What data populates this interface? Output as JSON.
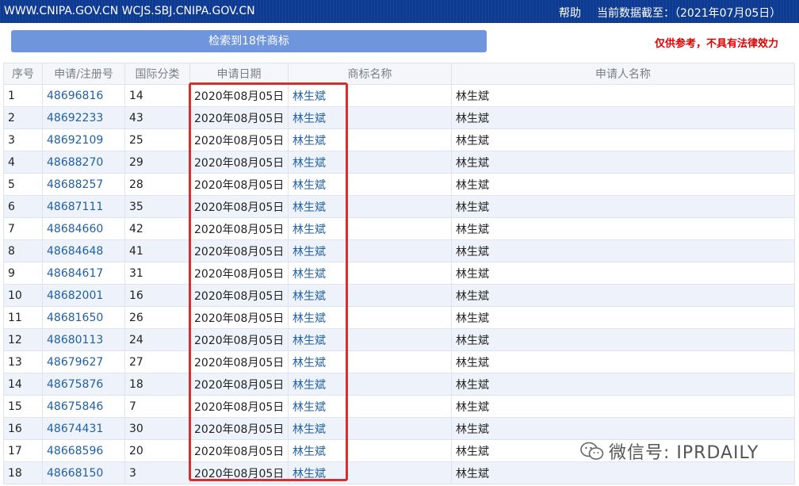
{
  "topbar": {
    "site": "WWW.CNIPA.GOV.CN WCJS.SBJ.CNIPA.GOV.CN",
    "help": "帮助",
    "as_of": "当前数据截至：（2021年07月05日）"
  },
  "result_summary": "检索到18件商标",
  "disclaimer": "仅供参考，不具有法律效力",
  "table": {
    "headers": [
      "序号",
      "申请/注册号",
      "国际分类",
      "申请日期",
      "商标名称",
      "申请人名称"
    ],
    "rows": [
      {
        "no": "1",
        "reg": "48696816",
        "cls": "14",
        "date": "2020年08月05日",
        "name": "林生斌",
        "applicant": "林生斌"
      },
      {
        "no": "2",
        "reg": "48692233",
        "cls": "43",
        "date": "2020年08月05日",
        "name": "林生斌",
        "applicant": "林生斌"
      },
      {
        "no": "3",
        "reg": "48692109",
        "cls": "25",
        "date": "2020年08月05日",
        "name": "林生斌",
        "applicant": "林生斌"
      },
      {
        "no": "4",
        "reg": "48688270",
        "cls": "29",
        "date": "2020年08月05日",
        "name": "林生斌",
        "applicant": "林生斌"
      },
      {
        "no": "5",
        "reg": "48688257",
        "cls": "28",
        "date": "2020年08月05日",
        "name": "林生斌",
        "applicant": "林生斌"
      },
      {
        "no": "6",
        "reg": "48687111",
        "cls": "35",
        "date": "2020年08月05日",
        "name": "林生斌",
        "applicant": "林生斌"
      },
      {
        "no": "7",
        "reg": "48684660",
        "cls": "42",
        "date": "2020年08月05日",
        "name": "林生斌",
        "applicant": "林生斌"
      },
      {
        "no": "8",
        "reg": "48684648",
        "cls": "41",
        "date": "2020年08月05日",
        "name": "林生斌",
        "applicant": "林生斌"
      },
      {
        "no": "9",
        "reg": "48684617",
        "cls": "31",
        "date": "2020年08月05日",
        "name": "林生斌",
        "applicant": "林生斌"
      },
      {
        "no": "10",
        "reg": "48682001",
        "cls": "16",
        "date": "2020年08月05日",
        "name": "林生斌",
        "applicant": "林生斌"
      },
      {
        "no": "11",
        "reg": "48681650",
        "cls": "26",
        "date": "2020年08月05日",
        "name": "林生斌",
        "applicant": "林生斌"
      },
      {
        "no": "12",
        "reg": "48680113",
        "cls": "24",
        "date": "2020年08月05日",
        "name": "林生斌",
        "applicant": "林生斌"
      },
      {
        "no": "13",
        "reg": "48679627",
        "cls": "27",
        "date": "2020年08月05日",
        "name": "林生斌",
        "applicant": "林生斌"
      },
      {
        "no": "14",
        "reg": "48675876",
        "cls": "18",
        "date": "2020年08月05日",
        "name": "林生斌",
        "applicant": "林生斌"
      },
      {
        "no": "15",
        "reg": "48675846",
        "cls": "7",
        "date": "2020年08月05日",
        "name": "林生斌",
        "applicant": "林生斌"
      },
      {
        "no": "16",
        "reg": "48674431",
        "cls": "30",
        "date": "2020年08月05日",
        "name": "林生斌",
        "applicant": "林生斌"
      },
      {
        "no": "17",
        "reg": "48668596",
        "cls": "20",
        "date": "2020年08月05日",
        "name": "林生斌",
        "applicant": "林生斌"
      },
      {
        "no": "18",
        "reg": "48668150",
        "cls": "3",
        "date": "2020年08月05日",
        "name": "林生斌",
        "applicant": "林生斌"
      }
    ]
  },
  "watermark": {
    "icon": "wechat-icon",
    "text": "微信号: IPRDAILY"
  },
  "colors": {
    "topbar": "#0d3a92",
    "result_bar": "#6f96dd",
    "disclaimer": "#e00000",
    "highlight_box": "#d92e2e",
    "link": "#1f5fa3"
  }
}
